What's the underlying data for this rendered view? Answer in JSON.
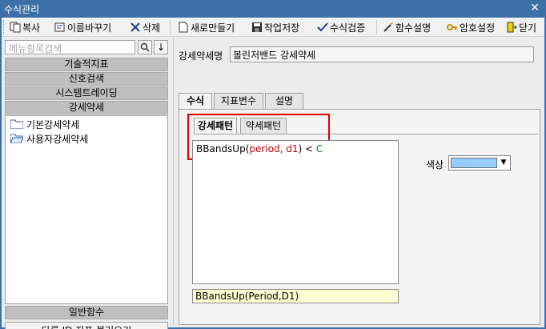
{
  "window": {
    "title": "수식관리",
    "close_glyph": "✕"
  },
  "toolbar": {
    "copy": "복사",
    "rename": "이름바꾸기",
    "delete": "삭제",
    "new": "새로만들기",
    "save": "작업저장",
    "verify": "수식검증",
    "func_desc": "함수설명",
    "password": "암호설정",
    "close": "닫기"
  },
  "left": {
    "search_placeholder": "메뉴항목검색",
    "search_btn": "🔍",
    "down_btn": "↓",
    "categories": [
      "기술적지표",
      "신호검색",
      "시스템트레이딩",
      "강세약세"
    ],
    "tree_items": [
      "기본강세약세",
      "사용자강세약세"
    ],
    "general_functions": "일반함수",
    "load_other_id": "다른 ID 지표 불러오기"
  },
  "right": {
    "name_label": "강세약세명",
    "name_value": "볼린저밴드 강세약세",
    "tabs": [
      "수식",
      "지표변수",
      "설명"
    ],
    "subtabs": [
      "강세패턴",
      "약세패턴"
    ],
    "formula": {
      "fn": "BBandsUp(",
      "args": "period, d1",
      "close": ")",
      "op": " < ",
      "var": "C"
    },
    "expression": "BBandsUp(Period,D1)",
    "color_label": "색상",
    "color_value": "#99ccff",
    "dropdown_glyph": "▼"
  }
}
